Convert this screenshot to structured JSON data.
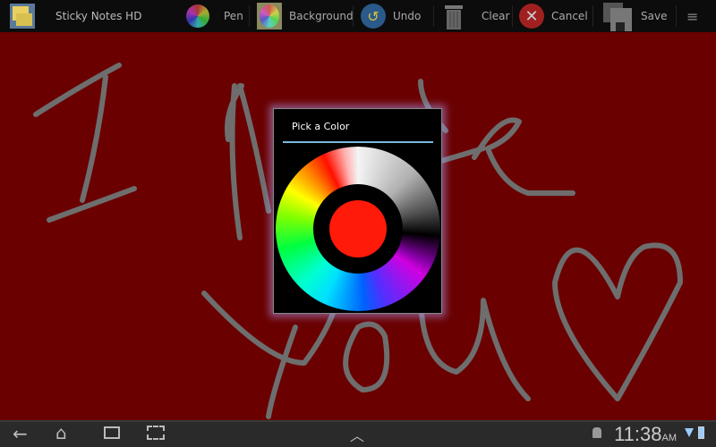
{
  "app": {
    "title": "Sticky Notes HD",
    "icon": "sticky-notes-app-icon"
  },
  "toolbar": {
    "pen": "Pen",
    "background": "Background",
    "undo": "Undo",
    "clear": "Clear",
    "cancel": "Cancel",
    "save": "Save"
  },
  "dialog": {
    "title": "Pick a Color",
    "selected_color": "#ff1a0a"
  },
  "canvas": {
    "background_color": "#6a0000",
    "stroke_color": "#6e6e6e"
  },
  "status": {
    "time": "11:38",
    "ampm": "AM"
  }
}
